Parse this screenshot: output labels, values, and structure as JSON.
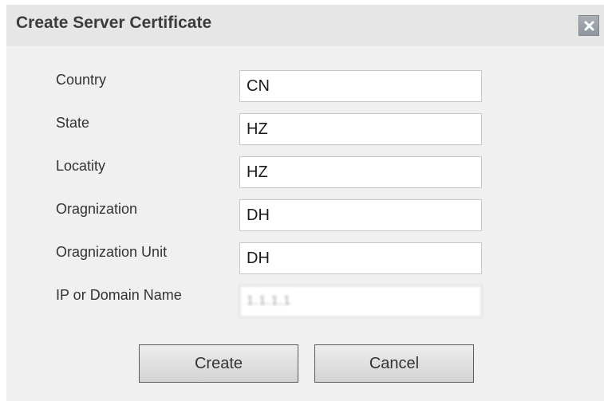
{
  "dialog": {
    "title": "Create Server Certificate",
    "close_icon": "close-icon"
  },
  "fields": [
    {
      "label": "Country",
      "value": "CN"
    },
    {
      "label": "State",
      "value": "HZ"
    },
    {
      "label": "Locatity",
      "value": "HZ"
    },
    {
      "label": "Oragnization",
      "value": "DH"
    },
    {
      "label": "Oragnization Unit",
      "value": "DH"
    },
    {
      "label": "IP or Domain Name",
      "value": "1.1.1.1"
    }
  ],
  "buttons": {
    "create_label": "Create",
    "cancel_label": "Cancel"
  },
  "colors": {
    "dialog_bg": "#f0f0f0",
    "titlebar_bg": "#e6e6e6",
    "close_button_bg": "#8e959c"
  }
}
